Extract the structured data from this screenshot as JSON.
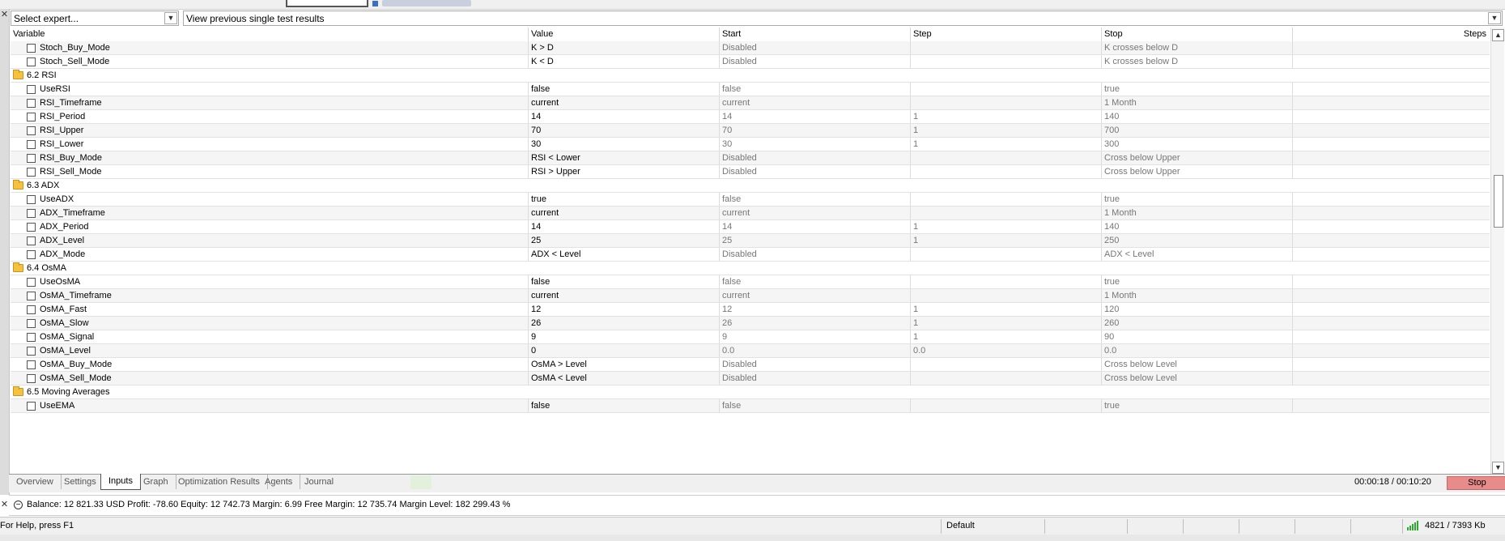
{
  "toolbar": {
    "expert_select": "Select expert...",
    "results_select": "View previous single test results"
  },
  "columns": [
    "Variable",
    "Value",
    "Start",
    "Step",
    "Stop",
    "Steps"
  ],
  "rows": [
    {
      "type": "param",
      "name": "Stoch_Buy_Mode",
      "value": "K > D",
      "start": "Disabled",
      "step": "",
      "stop": "K crosses below D",
      "steps": ""
    },
    {
      "type": "param",
      "name": "Stoch_Sell_Mode",
      "value": "K < D",
      "start": "Disabled",
      "step": "",
      "stop": "K crosses below D",
      "steps": ""
    },
    {
      "type": "group",
      "title": "6.2 RSI"
    },
    {
      "type": "param",
      "name": "UseRSI",
      "value": "false",
      "start": "false",
      "step": "",
      "stop": "true",
      "steps": ""
    },
    {
      "type": "param",
      "name": "RSI_Timeframe",
      "value": "current",
      "start": "current",
      "step": "",
      "stop": "1 Month",
      "steps": ""
    },
    {
      "type": "param",
      "name": "RSI_Period",
      "value": "14",
      "start": "14",
      "step": "1",
      "stop": "140",
      "steps": ""
    },
    {
      "type": "param",
      "name": "RSI_Upper",
      "value": "70",
      "start": "70",
      "step": "1",
      "stop": "700",
      "steps": ""
    },
    {
      "type": "param",
      "name": "RSI_Lower",
      "value": "30",
      "start": "30",
      "step": "1",
      "stop": "300",
      "steps": ""
    },
    {
      "type": "param",
      "name": "RSI_Buy_Mode",
      "value": "RSI < Lower",
      "start": "Disabled",
      "step": "",
      "stop": "Cross below Upper",
      "steps": ""
    },
    {
      "type": "param",
      "name": "RSI_Sell_Mode",
      "value": "RSI > Upper",
      "start": "Disabled",
      "step": "",
      "stop": "Cross below Upper",
      "steps": ""
    },
    {
      "type": "group",
      "title": "6.3 ADX"
    },
    {
      "type": "param",
      "name": "UseADX",
      "value": "true",
      "start": "false",
      "step": "",
      "stop": "true",
      "steps": ""
    },
    {
      "type": "param",
      "name": "ADX_Timeframe",
      "value": "current",
      "start": "current",
      "step": "",
      "stop": "1 Month",
      "steps": ""
    },
    {
      "type": "param",
      "name": "ADX_Period",
      "value": "14",
      "start": "14",
      "step": "1",
      "stop": "140",
      "steps": ""
    },
    {
      "type": "param",
      "name": "ADX_Level",
      "value": "25",
      "start": "25",
      "step": "1",
      "stop": "250",
      "steps": ""
    },
    {
      "type": "param",
      "name": "ADX_Mode",
      "value": "ADX < Level",
      "start": "Disabled",
      "step": "",
      "stop": "ADX < Level",
      "steps": ""
    },
    {
      "type": "group",
      "title": "6.4 OsMA"
    },
    {
      "type": "param",
      "name": "UseOsMA",
      "value": "false",
      "start": "false",
      "step": "",
      "stop": "true",
      "steps": ""
    },
    {
      "type": "param",
      "name": "OsMA_Timeframe",
      "value": "current",
      "start": "current",
      "step": "",
      "stop": "1 Month",
      "steps": ""
    },
    {
      "type": "param",
      "name": "OsMA_Fast",
      "value": "12",
      "start": "12",
      "step": "1",
      "stop": "120",
      "steps": ""
    },
    {
      "type": "param",
      "name": "OsMA_Slow",
      "value": "26",
      "start": "26",
      "step": "1",
      "stop": "260",
      "steps": ""
    },
    {
      "type": "param",
      "name": "OsMA_Signal",
      "value": "9",
      "start": "9",
      "step": "1",
      "stop": "90",
      "steps": ""
    },
    {
      "type": "param",
      "name": "OsMA_Level",
      "value": "0",
      "start": "0.0",
      "step": "0.0",
      "stop": "0.0",
      "steps": ""
    },
    {
      "type": "param",
      "name": "OsMA_Buy_Mode",
      "value": "OsMA > Level",
      "start": "Disabled",
      "step": "",
      "stop": "Cross below Level",
      "steps": ""
    },
    {
      "type": "param",
      "name": "OsMA_Sell_Mode",
      "value": "OsMA < Level",
      "start": "Disabled",
      "step": "",
      "stop": "Cross below Level",
      "steps": ""
    },
    {
      "type": "group",
      "title": "6.5 Moving Averages"
    },
    {
      "type": "param",
      "name": "UseEMA",
      "value": "false",
      "start": "false",
      "step": "",
      "stop": "true",
      "steps": ""
    }
  ],
  "tabs": {
    "overview": "Overview",
    "settings": "Settings",
    "inputs": "Inputs",
    "graph": "Graph",
    "optimization": "Optimization Results",
    "agents": "Agents",
    "journal": "Journal"
  },
  "progress": {
    "timer": "00:00:18 / 00:10:20",
    "stop_label": "Stop"
  },
  "account": {
    "summary": "Balance: 12 821.33 USD  Profit: -78.60  Equity: 12 742.73  Margin: 6.99  Free Margin: 12 735.74  Margin Level: 182 299.43 %"
  },
  "statusbar": {
    "help": "For Help, press F1",
    "profile": "Default",
    "traffic": "4821 / 7393 Kb"
  },
  "colors": {
    "stop_button": "#e88b8b",
    "folder": "#f6c23e",
    "connection_bars": "#2faa2f"
  },
  "icons": [
    "close-icon",
    "dropdown-arrow-icon",
    "folder-icon",
    "checkbox",
    "scroll-up-icon",
    "scroll-down-icon",
    "minus-circle-icon",
    "connection-bars-icon"
  ]
}
